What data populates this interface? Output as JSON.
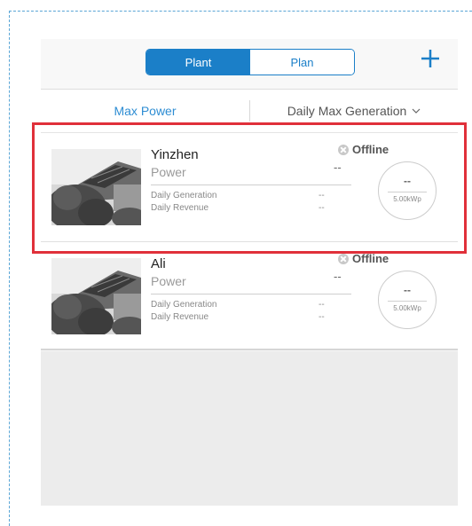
{
  "nav": {
    "segments": [
      {
        "label": "Plant",
        "active": true
      },
      {
        "label": "Plan",
        "active": false
      }
    ],
    "add_icon": "plus-icon",
    "accent_color": "#1b7fc8"
  },
  "filter": {
    "left_label": "Max Power",
    "right_label": "Daily Max Generation",
    "dropdown_icon": "chevron-down-icon"
  },
  "plants": [
    {
      "name": "Yinzhen",
      "power_label": "Power",
      "power_value": "--",
      "status": "Offline",
      "status_icon": "offline-x-icon",
      "daily_generation_label": "Daily Generation",
      "daily_generation_value": "--",
      "daily_revenue_label": "Daily Revenue",
      "daily_revenue_value": "--",
      "gauge_value": "--",
      "capacity": "5.00kWp",
      "highlighted": true
    },
    {
      "name": "Ali",
      "power_label": "Power",
      "power_value": "--",
      "status": "Offline",
      "status_icon": "offline-x-icon",
      "daily_generation_label": "Daily Generation",
      "daily_generation_value": "--",
      "daily_revenue_label": "Daily Revenue",
      "daily_revenue_value": "--",
      "gauge_value": "--",
      "capacity": "5.00kWp",
      "highlighted": false
    }
  ],
  "highlight_color": "#e0303a"
}
